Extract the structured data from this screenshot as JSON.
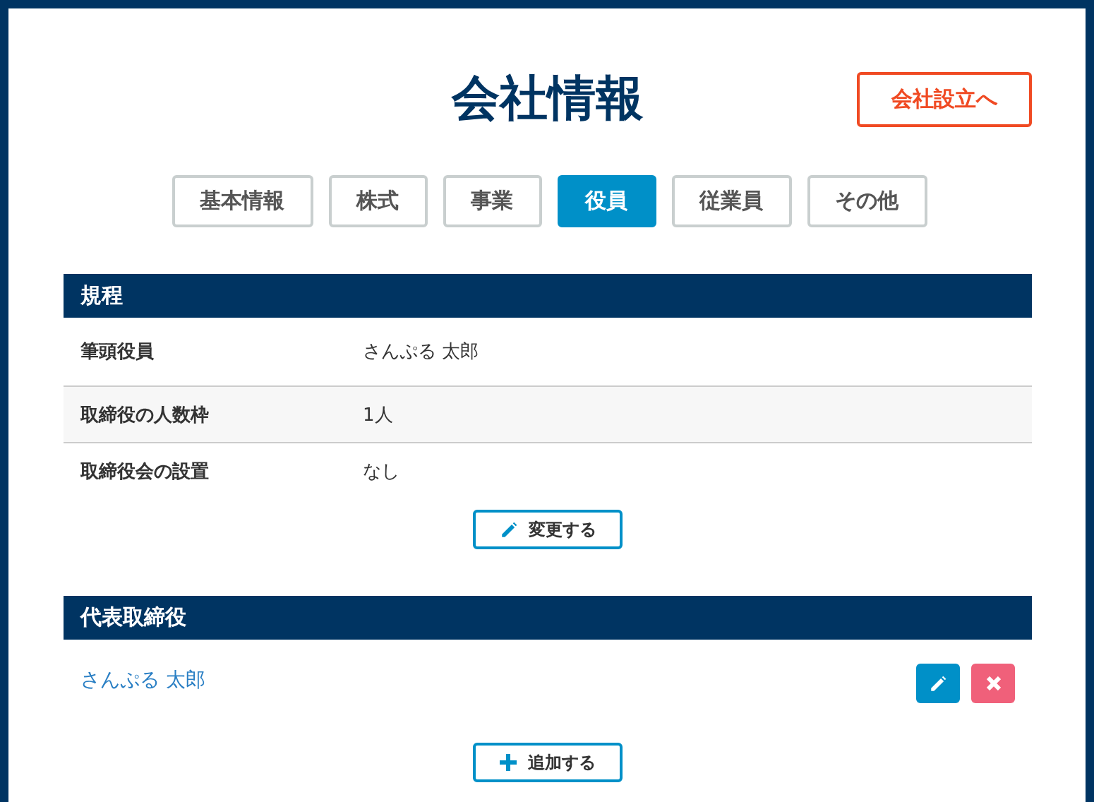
{
  "title": "会社情報",
  "establish_button": "会社設立へ",
  "tabs": [
    {
      "label": "基本情報",
      "selected": false
    },
    {
      "label": "株式",
      "selected": false
    },
    {
      "label": "事業",
      "selected": false
    },
    {
      "label": "役員",
      "selected": true
    },
    {
      "label": "従業員",
      "selected": false
    },
    {
      "label": "その他",
      "selected": false
    }
  ],
  "rules_section": {
    "heading": "規程",
    "rows": [
      {
        "label": "筆頭役員",
        "value": "さんぷる 太郎"
      },
      {
        "label": "取締役の人数枠",
        "value": "1人"
      },
      {
        "label": "取締役会の設置",
        "value": "なし"
      }
    ],
    "change_button": "変更する"
  },
  "representatives_section": {
    "heading": "代表取締役",
    "people": [
      {
        "name": "さんぷる 太郎"
      }
    ],
    "add_button": "追加する"
  }
}
